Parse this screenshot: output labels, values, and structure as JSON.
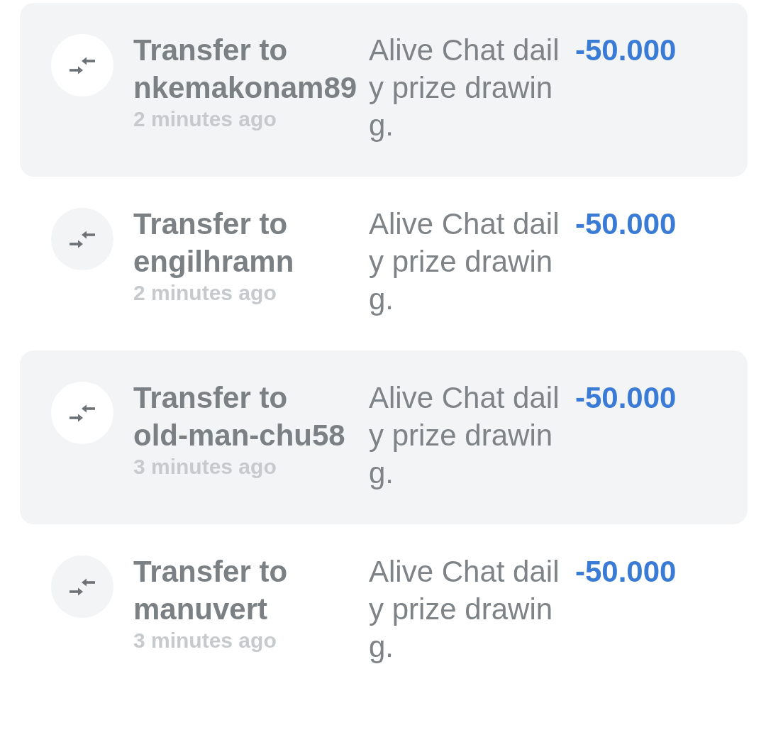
{
  "transactions": [
    {
      "title": "Transfer to nkemakonam89",
      "time": "2 minutes ago",
      "description": "Alive Chat daily prize drawing.",
      "amount": "-50.000"
    },
    {
      "title": "Transfer to engilhramn",
      "time": "2 minutes ago",
      "description": "Alive Chat daily prize drawing.",
      "amount": "-50.000"
    },
    {
      "title": "Transfer to old-man-chu58",
      "time": "3 minutes ago",
      "description": "Alive Chat daily prize drawing.",
      "amount": "-50.000"
    },
    {
      "title": "Transfer to manuvert",
      "time": "3 minutes ago",
      "description": "Alive Chat daily prize drawing.",
      "amount": "-50.000"
    }
  ]
}
